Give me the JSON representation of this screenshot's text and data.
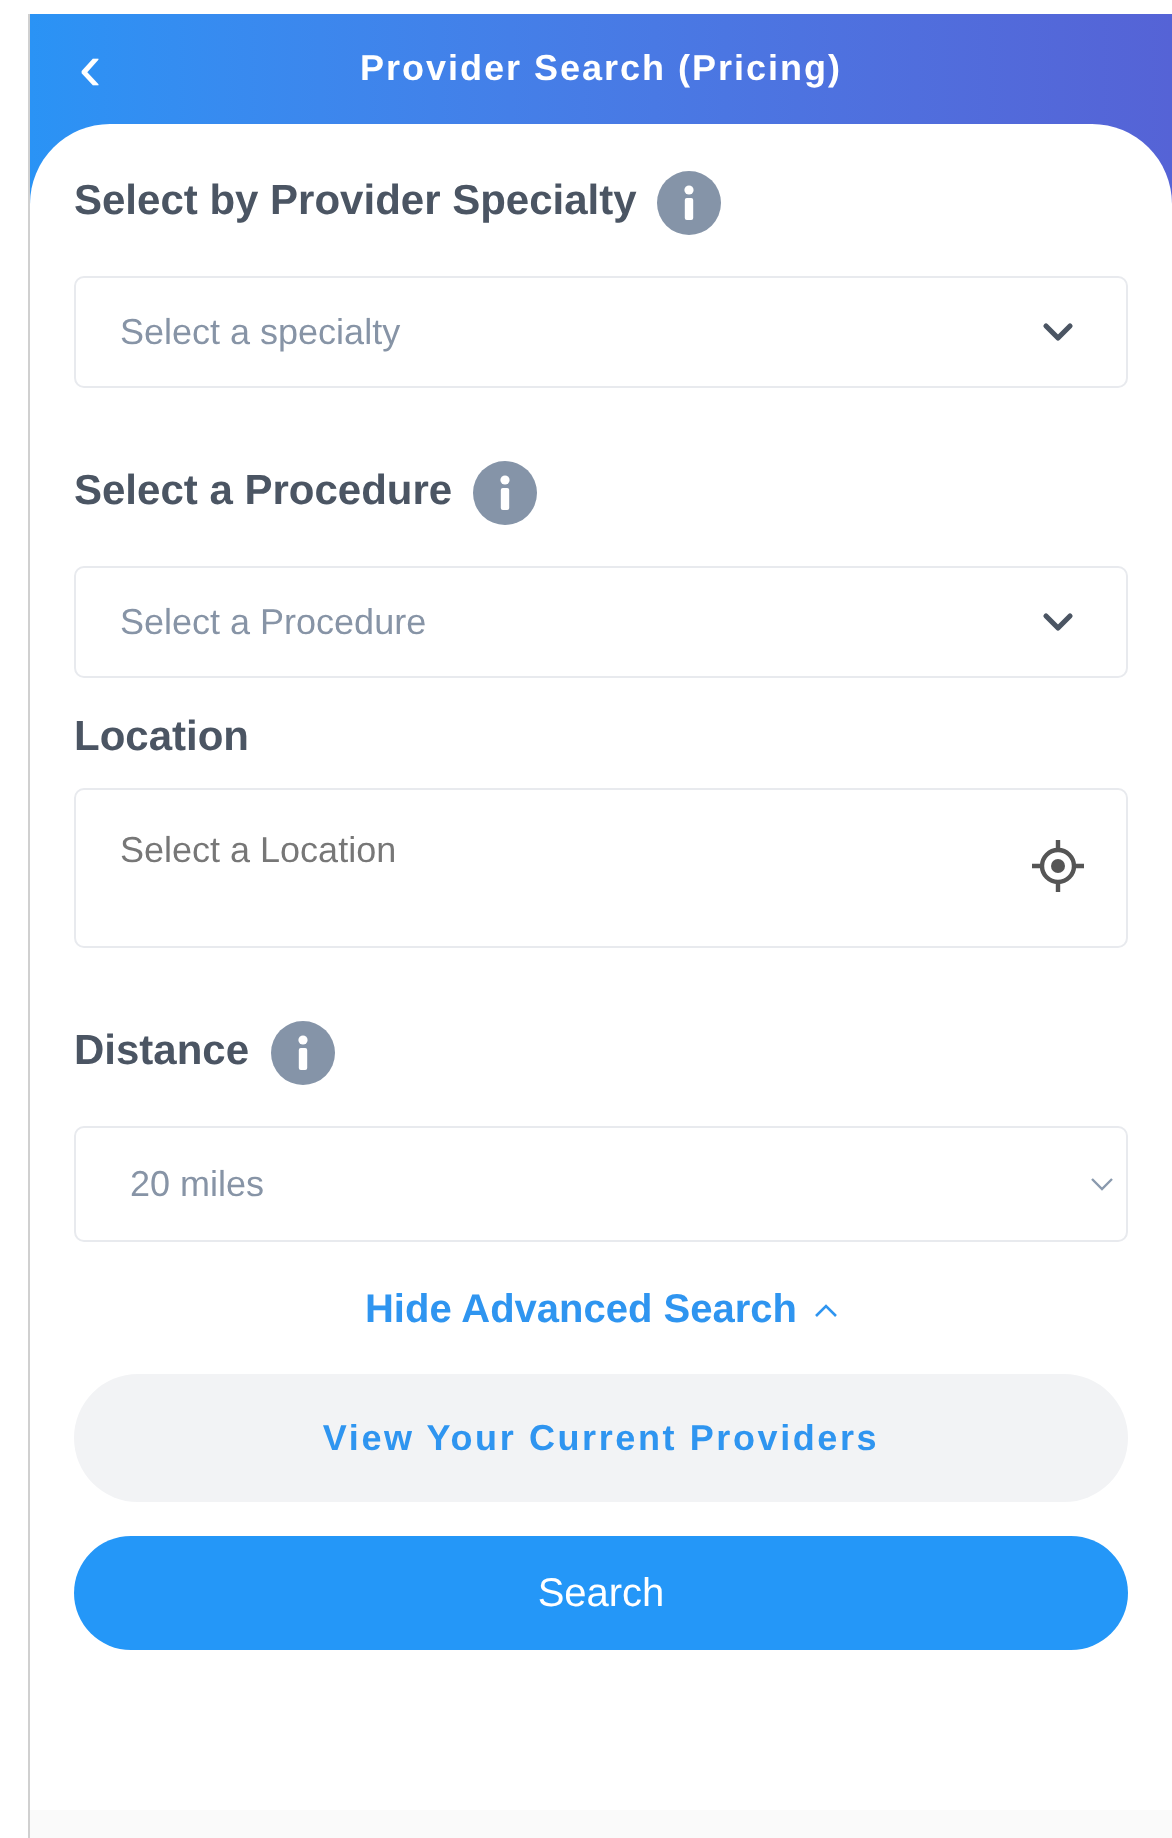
{
  "header": {
    "back_icon": "‹",
    "title": "Provider Search (Pricing)"
  },
  "fields": [
    {
      "kind": "dropdown",
      "label": "Select by Provider Specialty",
      "info": true,
      "placeholder": "Select a specialty"
    },
    {
      "kind": "dropdown",
      "label": "Select a Procedure",
      "info": true,
      "placeholder": "Select a Procedure"
    },
    {
      "kind": "location",
      "label": "Location",
      "info": false,
      "placeholder": "Select a Location"
    },
    {
      "kind": "select",
      "label": "Distance",
      "info": true,
      "value": "20 miles"
    }
  ],
  "advanced_toggle": {
    "label": "Hide Advanced Search",
    "expanded": true
  },
  "buttons": [
    {
      "kind": "secondary",
      "label": "View Your Current Providers"
    },
    {
      "kind": "primary",
      "label": "Search"
    }
  ]
}
